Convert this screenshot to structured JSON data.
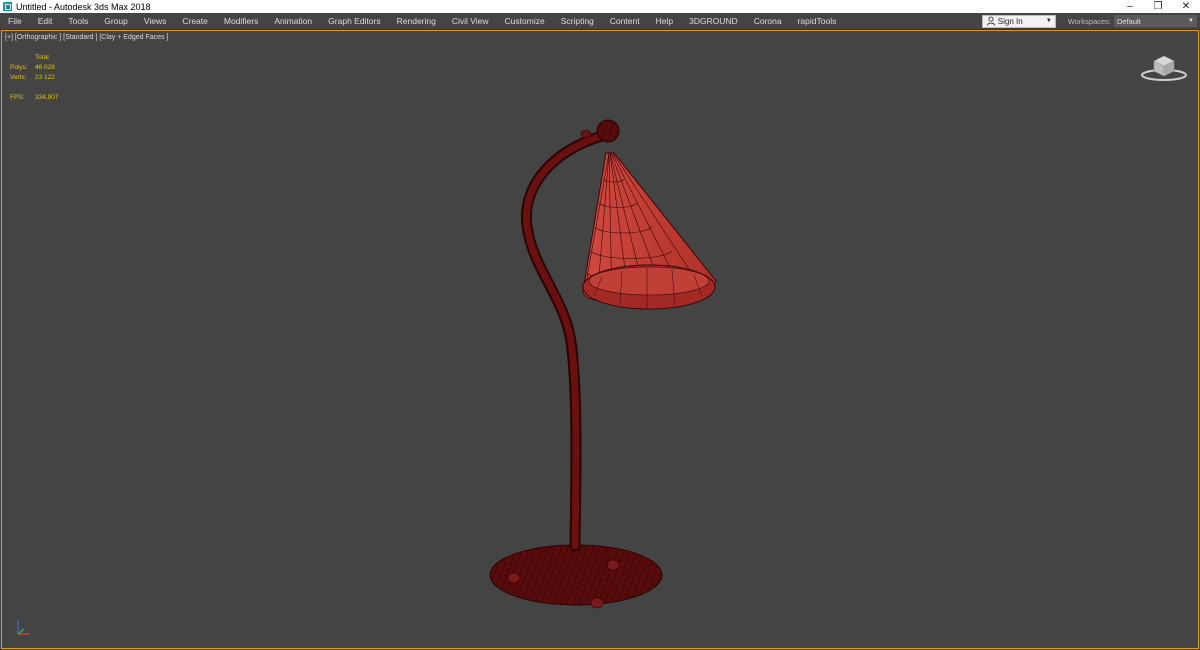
{
  "window": {
    "title": "Untitled - Autodesk 3ds Max 2018",
    "controls": {
      "minimize": "–",
      "restore": "❐",
      "close": "✕"
    }
  },
  "menubar": {
    "items": [
      "File",
      "Edit",
      "Tools",
      "Group",
      "Views",
      "Create",
      "Modifiers",
      "Animation",
      "Graph Editors",
      "Rendering",
      "Civil View",
      "Customize",
      "Scripting",
      "Content",
      "Help",
      "3DGROUND",
      "Corona",
      "rapidTools"
    ],
    "signin_label": "Sign In",
    "workspaces_label": "Workspaces:",
    "workspace_value": "Default"
  },
  "viewport": {
    "label": "[+] [Orthographic ] [Standard ] [Clay + Edged Faces ]",
    "stats": {
      "header": "Total",
      "polys_label": "Polys:",
      "polys_value": "46 028",
      "verts_label": "Verts:",
      "verts_value": "23 122",
      "fps_label": "FPS:",
      "fps_value": "334,907"
    }
  },
  "colors": {
    "viewport_bg": "#444444",
    "active_border": "#d8a01a",
    "stats_text": "#e1c21a",
    "model_red": "#b33a33",
    "wire_dark": "#3a0505"
  },
  "icons": {
    "app": "3dsmax-app-icon",
    "user": "user-icon",
    "viewcube": "viewcube-icon",
    "axis": "axis-tripod-icon"
  }
}
